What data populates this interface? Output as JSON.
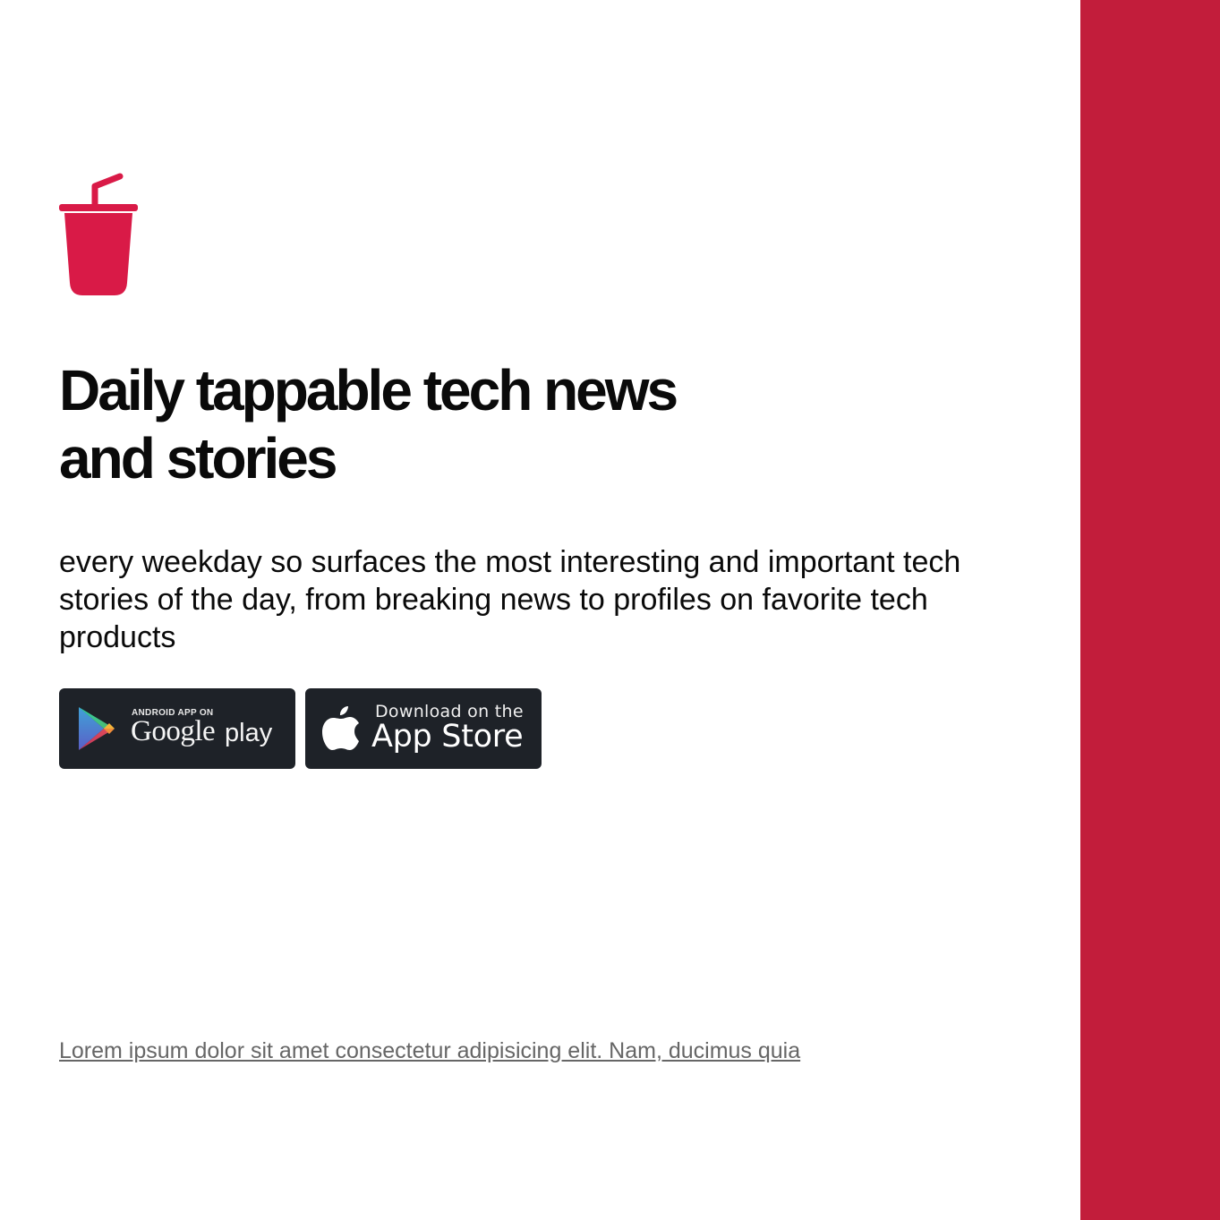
{
  "brand": {
    "logo_icon": "cup-with-straw-icon",
    "accent_color": "#c21d3b",
    "logo_color": "#d91a47"
  },
  "hero": {
    "headline_line1": "Daily tappable tech news",
    "headline_line2": "and stories",
    "description": "every weekday so surfaces the most interesting and important tech stories of the day, from breaking news to profiles on favorite tech products"
  },
  "stores": {
    "google": {
      "icon": "google-play-icon",
      "small_label": "ANDROID APP ON",
      "brand_label": "Google",
      "product_label": "play"
    },
    "apple": {
      "icon": "apple-icon",
      "small_label": "Download on the",
      "big_label": "App Store"
    }
  },
  "footer": {
    "link_text": "Lorem ipsum dolor sit amet consectetur adipisicing elit. Nam, ducimus quia"
  }
}
